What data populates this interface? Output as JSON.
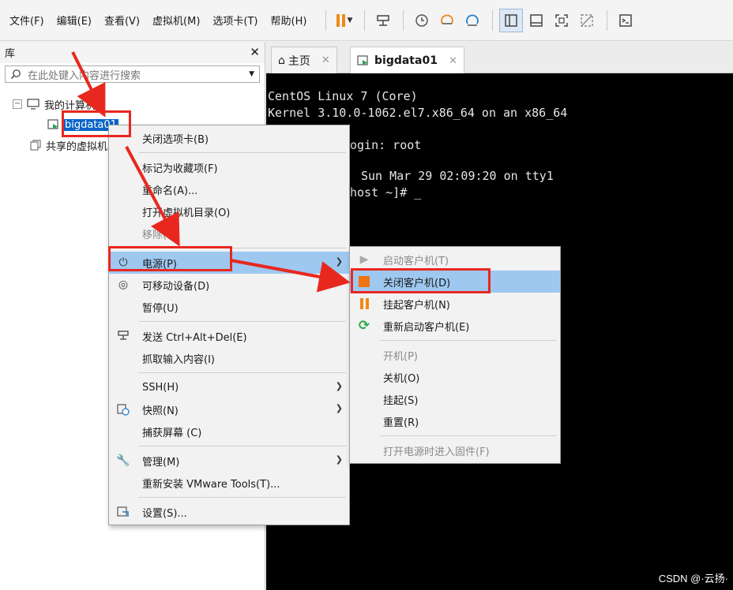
{
  "menubar": {
    "items": [
      "文件(F)",
      "编辑(E)",
      "查看(V)",
      "虚拟机(M)",
      "选项卡(T)",
      "帮助(H)"
    ]
  },
  "library": {
    "title": "库",
    "close": "✕",
    "search_placeholder": "在此处键入内容进行搜索",
    "tree": {
      "my_computer": "我的计算机",
      "vm": "bigdata01",
      "shared": "共享的虚拟机"
    }
  },
  "tabs": [
    {
      "label": "主页"
    },
    {
      "label": "bigdata01",
      "active": true
    }
  ],
  "console": {
    "lines": [
      "CentOS Linux 7 (Core)",
      "Kernel 3.10.0-1062.el7.x86_64 on an x86_64",
      "",
      "ogin: root",
      "Sun Mar 29 02:09:20 on tty1",
      "host ~]# _"
    ],
    "watermark": "CSDN @·云扬·"
  },
  "context_menu": {
    "close_tab": "关闭选项卡(B)",
    "favorite": "标记为收藏项(F)",
    "rename": "重命名(A)...",
    "open_dir": "打开虚拟机目录(O)",
    "remove": "移除(R)",
    "power": "电源(P)",
    "removable": "可移动设备(D)",
    "pause": "暂停(U)",
    "send_cad": "发送 Ctrl+Alt+Del(E)",
    "grab_input": "抓取输入内容(I)",
    "ssh": "SSH(H)",
    "snapshot": "快照(N)",
    "capture": "捕获屏幕 (C)",
    "manage": "管理(M)",
    "reinstall_tools": "重新安装 VMware Tools(T)...",
    "settings": "设置(S)..."
  },
  "power_menu": {
    "start_guest": "启动客户机(T)",
    "shutdown_guest": "关闭客户机(D)",
    "suspend_guest": "挂起客户机(N)",
    "restart_guest": "重新启动客户机(E)",
    "power_on": "开机(P)",
    "power_off": "关机(O)",
    "suspend": "挂起(S)",
    "reset": "重置(R)",
    "firmware": "打开电源时进入固件(F)"
  },
  "colors": {
    "accent_orange": "#f08a14",
    "highlight": "#9ec8f0",
    "annotation_red": "#e8281f",
    "selection_blue": "#0a64c8"
  }
}
